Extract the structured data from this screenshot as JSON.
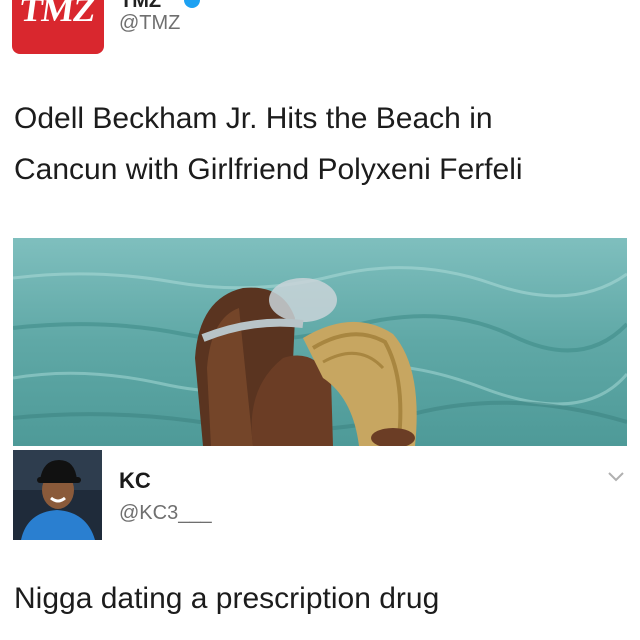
{
  "tweet": {
    "logo_text": "TMZ",
    "account_name_partial": "TMZ",
    "handle": "@TMZ",
    "text_line1": "Odell Beckham Jr. Hits the Beach in",
    "text_line2": "Cancun with Girlfriend Polyxeni Ferfeli",
    "photo_icon": "beach-couple-photo"
  },
  "reply": {
    "name": "KC",
    "handle": "@KC3___",
    "text": "Nigga dating a prescription drug",
    "avatar_icon": "user-avatar",
    "menu_icon": "chevron-down-icon"
  },
  "colors": {
    "tmz_red": "#d9272e",
    "verified_blue": "#1da1f2",
    "handle_gray": "#6f6f6f",
    "sea": "#5fa8a6"
  }
}
